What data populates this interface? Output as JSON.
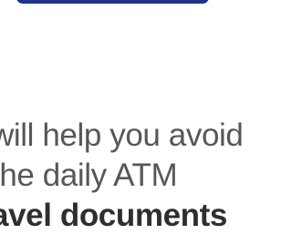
{
  "top_button": {
    "color": "#1f3389"
  },
  "content": {
    "lines": [
      "will help you avoid",
      "the daily ATM",
      "avel documents"
    ]
  }
}
